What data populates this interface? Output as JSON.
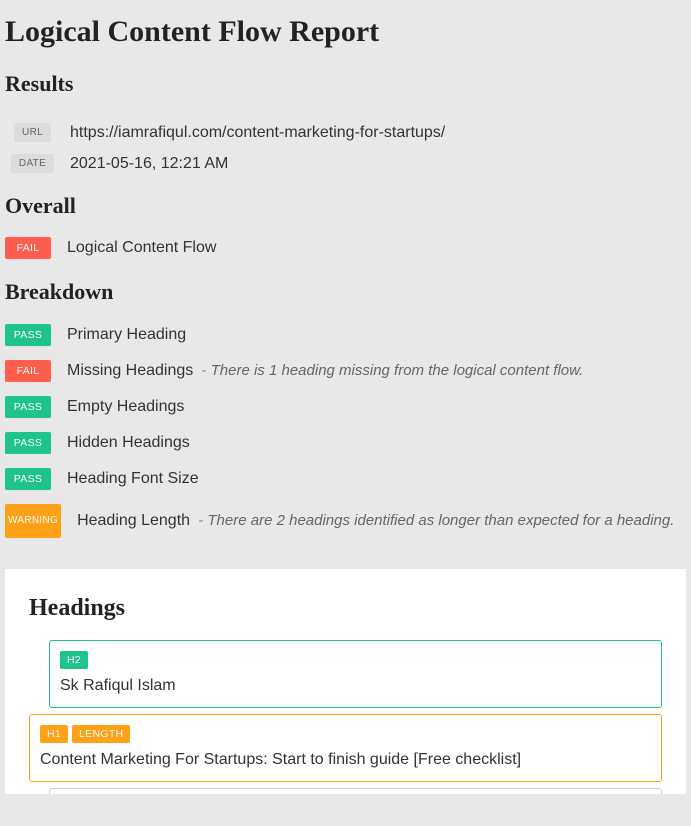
{
  "title": "Logical Content Flow Report",
  "resultsTitle": "Results",
  "meta": [
    {
      "label": "URL",
      "value": "https://iamrafiqul.com/content-marketing-for-startups/"
    },
    {
      "label": "DATE",
      "value": "2021-05-16, 12:21 AM"
    }
  ],
  "overallTitle": "Overall",
  "overall": {
    "status": "FAIL",
    "statusColor": "#ff5e4d",
    "text": "Logical Content Flow"
  },
  "breakdownTitle": "Breakdown",
  "breakdown": [
    {
      "status": "PASS",
      "statusColor": "#1fc48a",
      "text": "Primary Heading",
      "note": ""
    },
    {
      "status": "FAIL",
      "statusColor": "#ff5e4d",
      "text": "Missing Headings",
      "note": "There is 1 heading missing from the logical content flow."
    },
    {
      "status": "PASS",
      "statusColor": "#1fc48a",
      "text": "Empty Headings",
      "note": ""
    },
    {
      "status": "PASS",
      "statusColor": "#1fc48a",
      "text": "Hidden Headings",
      "note": ""
    },
    {
      "status": "PASS",
      "statusColor": "#1fc48a",
      "text": "Heading Font Size",
      "note": ""
    },
    {
      "status": "WARNING",
      "statusColor": "#ffa117",
      "text": "Heading Length",
      "note": "There are 2 headings identified as longer than expected for a heading."
    }
  ],
  "headingsTitle": "Headings",
  "headings": [
    {
      "indent": 1,
      "borderColor": "#1fc48a",
      "tags": [
        {
          "text": "H2",
          "color": "#1fc48a"
        }
      ],
      "text": "Sk Rafiqul Islam"
    },
    {
      "indent": 0,
      "borderColor": "#ffa117",
      "tags": [
        {
          "text": "H1",
          "color": "#ffa117"
        },
        {
          "text": "LENGTH",
          "color": "#ffa117"
        }
      ],
      "text": "Content Marketing For Startups: Start to finish guide [Free checklist]"
    }
  ]
}
